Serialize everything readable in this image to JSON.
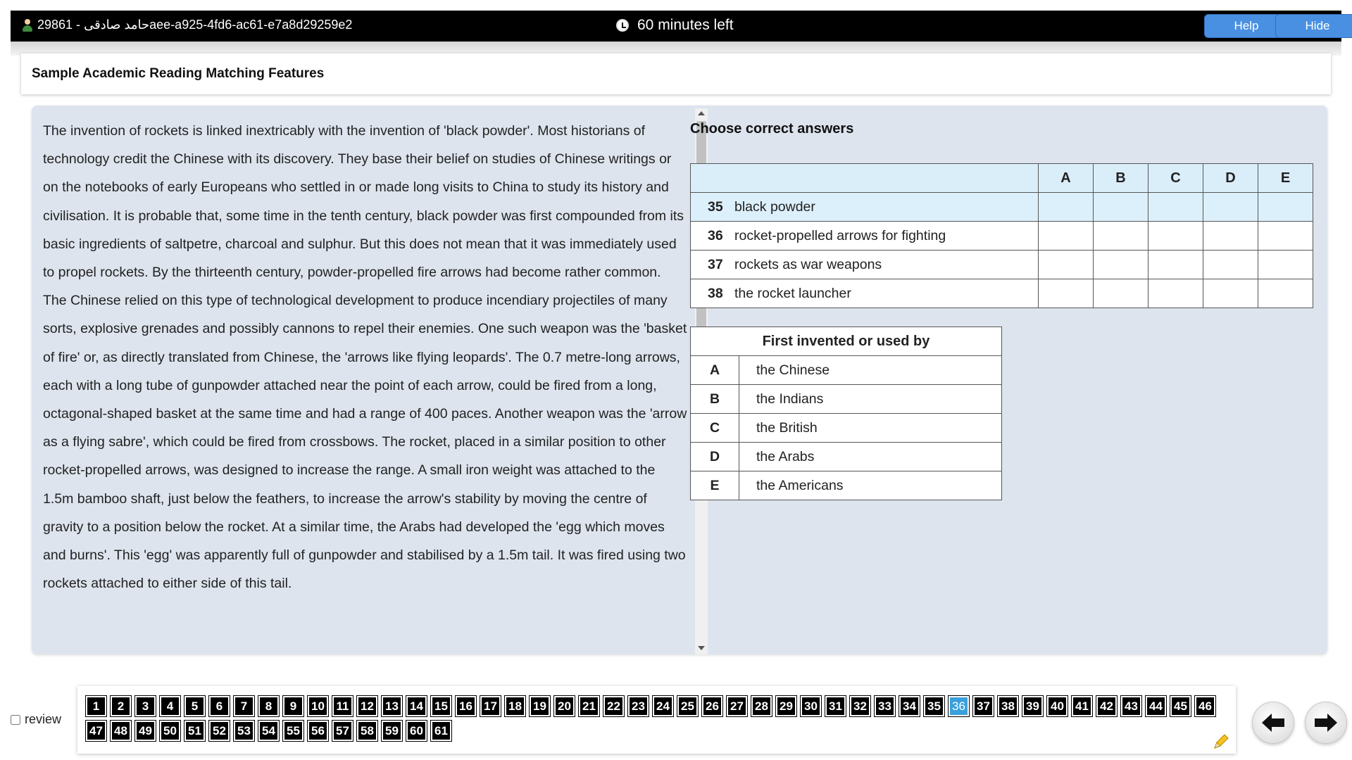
{
  "header": {
    "candidate": "29861 - حامد صادقیaee-a925-4fd6-ac61-e7a8d29259e2",
    "timer": "60 minutes left",
    "help_label": "Help",
    "hide_label": "Hide"
  },
  "title": "Sample Academic Reading Matching Features",
  "passage": "The invention of rockets is linked inextricably with the invention of 'black powder'. Most historians of technology credit the Chinese with its discovery. They base their belief on studies of Chinese writings or on the notebooks of early Europeans who settled in or made long visits to China to study its history and civilisation. It is probable that, some time in the tenth century, black powder was first compounded from its basic ingredients of saltpetre, charcoal and sulphur. But this does not mean that it was immediately used to propel rockets. By the thirteenth century, powder-propelled fire arrows had become rather common. The Chinese relied on this type of technological development to produce incendiary projectiles of many sorts, explosive grenades and possibly cannons to repel their enemies. One such weapon was the 'basket of fire' or, as directly translated from Chinese, the 'arrows like flying leopards'. The 0.7 metre-long arrows, each with a long tube of gunpowder attached near the point of each arrow, could be fired from a long, octagonal-shaped basket at the same time and had a range of 400 paces. Another weapon was the 'arrow as a flying sabre', which could be fired from crossbows. The rocket, placed in a similar position to other rocket-propelled arrows, was designed to increase the range. A small iron weight was attached to the 1.5m bamboo shaft, just below the feathers, to increase the arrow's stability by moving the centre of gravity to a position below the rocket. At a similar time, the Arabs had developed the 'egg which moves and burns'. This 'egg' was apparently full of gunpowder and stabilised by a 1.5m tail. It was fired using two rockets attached to either side of this tail.",
  "question": {
    "heading": "Choose correct answers",
    "columns": [
      "A",
      "B",
      "C",
      "D",
      "E"
    ],
    "rows": [
      {
        "num": "35",
        "text": "black powder"
      },
      {
        "num": "36",
        "text": "rocket-propelled arrows for fighting"
      },
      {
        "num": "37",
        "text": "rockets as war weapons"
      },
      {
        "num": "38",
        "text": "the rocket launcher"
      }
    ]
  },
  "options": {
    "heading": "First invented or used by",
    "items": [
      {
        "letter": "A",
        "text": "the Chinese"
      },
      {
        "letter": "B",
        "text": "the Indians"
      },
      {
        "letter": "C",
        "text": "the British"
      },
      {
        "letter": "D",
        "text": "the Arabs"
      },
      {
        "letter": "E",
        "text": "the Americans"
      }
    ]
  },
  "nav": {
    "review_label": "review",
    "current": "36",
    "questions": [
      "1",
      "2",
      "3",
      "4",
      "5",
      "6",
      "7",
      "8",
      "9",
      "10",
      "11",
      "12",
      "13",
      "14",
      "15",
      "16",
      "17",
      "18",
      "19",
      "20",
      "21",
      "22",
      "23",
      "24",
      "25",
      "26",
      "27",
      "28",
      "29",
      "30",
      "31",
      "32",
      "33",
      "34",
      "35",
      "36",
      "37",
      "38",
      "39",
      "40",
      "41",
      "42",
      "43",
      "44",
      "45",
      "46",
      "47",
      "48",
      "49",
      "50",
      "51",
      "52",
      "53",
      "54",
      "55",
      "56",
      "57",
      "58",
      "59",
      "60",
      "61"
    ]
  },
  "colors": {
    "accent": "#4a90e2",
    "current_question": "#3aa0dd",
    "panel_bg": "#dde4ee",
    "table_header": "#daeefa"
  }
}
